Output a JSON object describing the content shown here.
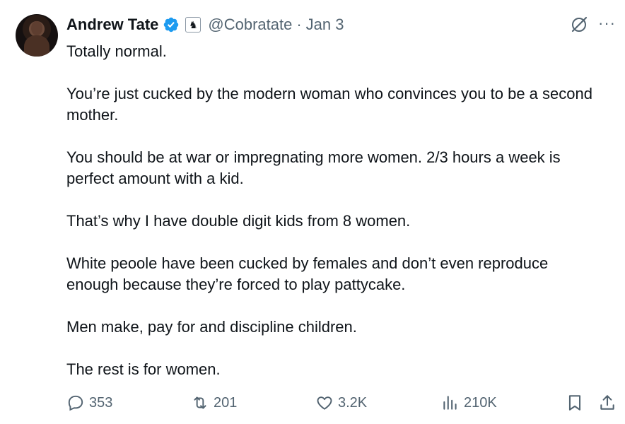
{
  "tweet": {
    "author_name": "Andrew Tate",
    "handle": "@Cobratate",
    "separator": "·",
    "date": "Jan 3",
    "more": "···",
    "paragraphs": [
      "Totally normal.",
      "You’re just cucked by the modern woman who convinces you to be a second mother.",
      "You should be at war or impregnating more women. 2/3 hours a week is perfect amount with a kid.",
      "That’s why I have double digit kids from 8 women.",
      "White peoole have been cucked by females and don’t even reproduce enough because they’re forced to play pattycake.",
      "Men make, pay for and discipline children.",
      "The rest is for women."
    ]
  },
  "actions": {
    "replies": "353",
    "reposts": "201",
    "likes": "3.2K",
    "views": "210K"
  },
  "icons": {
    "verified": "verified-badge-icon",
    "affiliate": "chess-knight-affiliate-icon",
    "grok": "grok-icon",
    "more": "more-icon",
    "reply": "reply-icon",
    "repost": "repost-icon",
    "like": "heart-icon",
    "views": "views-icon",
    "bookmark": "bookmark-icon",
    "share": "share-icon"
  },
  "colors": {
    "text": "#0f1419",
    "secondary": "#536471",
    "verified": "#1d9bf0"
  }
}
